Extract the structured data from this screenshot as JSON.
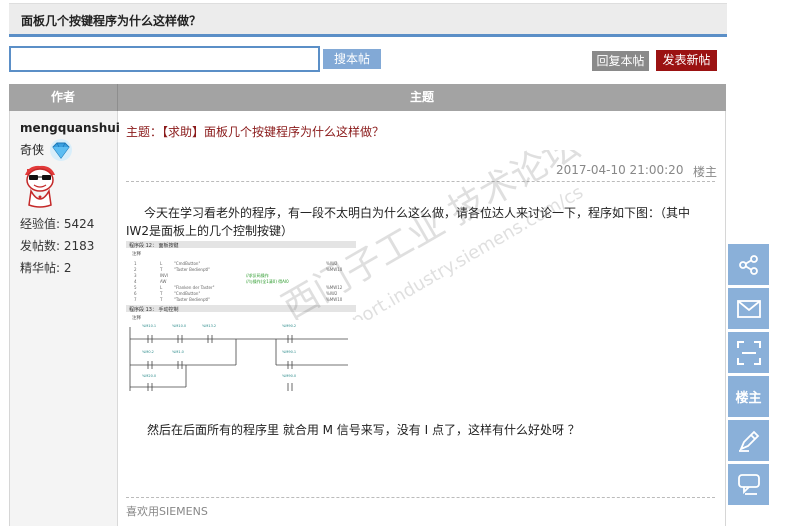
{
  "thread": {
    "title": "面板几个按键程序为什么这样做？"
  },
  "search": {
    "placeholder": "",
    "value": "",
    "button_label": "搜本帖"
  },
  "actions": {
    "reply_label": "回复本帖",
    "new_label": "发表新帖"
  },
  "table": {
    "col_author": "作者",
    "col_subject": "主题"
  },
  "author": {
    "name": "mengquanshui",
    "rank": "奇侠",
    "stats": [
      "经验值: 5424",
      "发帖数: 2183",
      "精华帖: 2"
    ]
  },
  "post": {
    "subject": "主题：【求助】面板几个按键程序为什么这样做？",
    "date": "2017-04-10 21:00:20",
    "floor_label": "楼主",
    "body_1": "今天在学习看老外的程序，有一段不太明白为什么这么做，请各位达人来讨论一下，程序如下图：（其中 IW2是面板上的几个控制按键）",
    "body_2": "然后在后面所有的程序里 就合用 M 信号来写，没有 I 点了，这样有什么好处呀 ？",
    "signature": "喜欢用SIEMENS",
    "image": {
      "segment_12": "程序段 12： 面板按键",
      "segment_12_comment": "注释",
      "segment_13": "程序段 13： 手动控制",
      "segment_13_comment": "注释"
    }
  },
  "side_tools": {
    "share_icon": "share-icon",
    "mail_icon": "mail-icon",
    "qr_icon": "qr-code-icon",
    "floor_label": "楼主",
    "edit_icon": "edit-icon",
    "reply_icon": "reply-icon"
  },
  "watermark": {
    "line1": "西门子工业  技术论坛",
    "line2": "support.industry.siemens.com/cs"
  }
}
